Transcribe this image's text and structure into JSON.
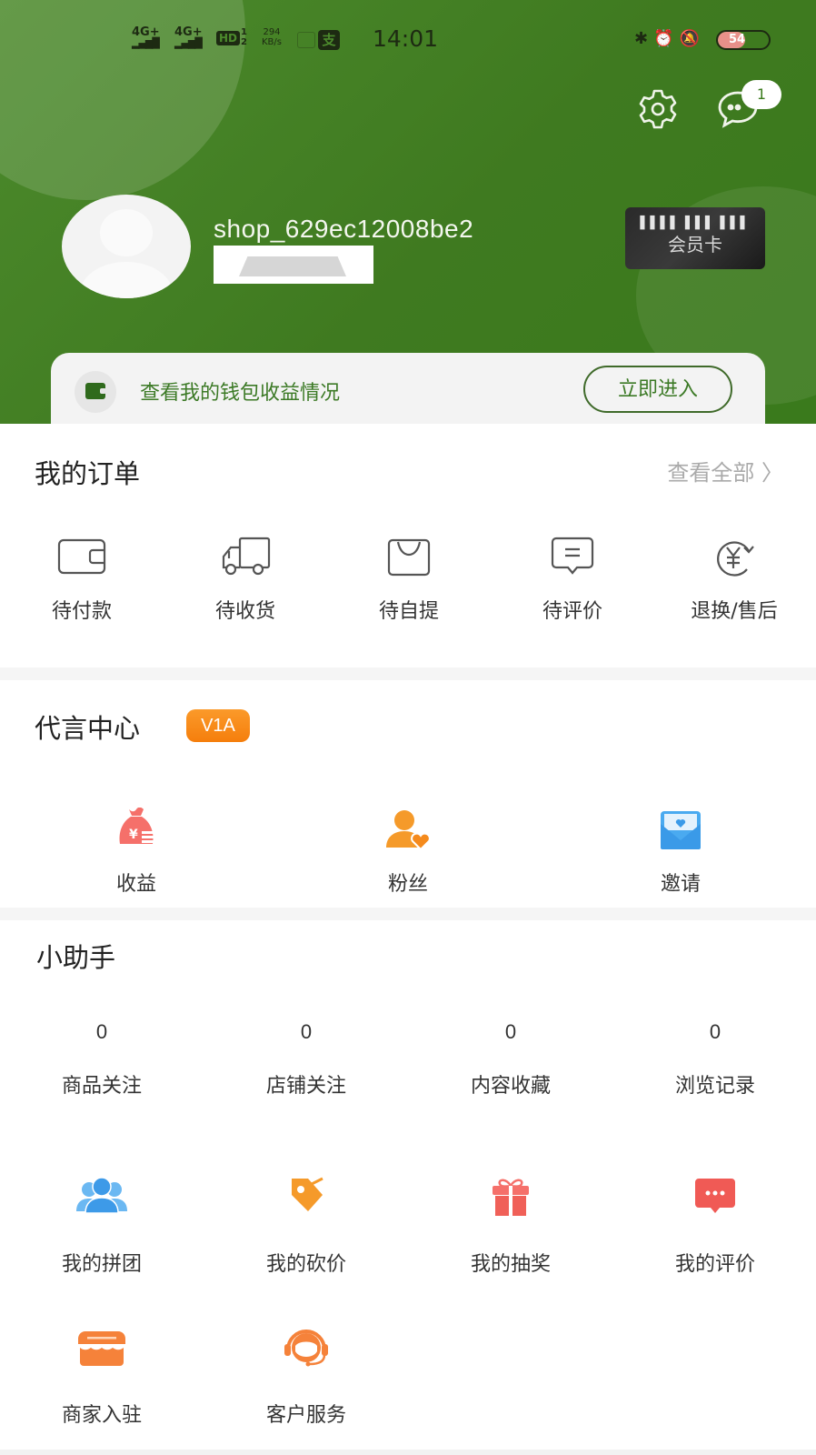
{
  "status_bar": {
    "signal1": "4G+",
    "signal2": "4G+",
    "hd": "HD",
    "hd_sim": "1 2",
    "speed_value": "294",
    "speed_unit": "KB/s",
    "pay_icon": "支",
    "time": "14:01",
    "battery": "54",
    "battery_level": 0.54
  },
  "header": {
    "message_badge": "1",
    "username": "shop_629ec12008be2",
    "member_card": {
      "barcode": "▌▌▌▌ ▌▌▌ ▌▌▌",
      "label": "会员卡"
    },
    "wallet": {
      "text": "查看我的钱包收益情况",
      "button": "立即进入"
    }
  },
  "orders": {
    "title": "我的订单",
    "view_all": "查看全部 〉",
    "items": [
      {
        "label": "待付款",
        "icon": "wallet-icon"
      },
      {
        "label": "待收货",
        "icon": "truck-icon"
      },
      {
        "label": "待自提",
        "icon": "shopping-bag-icon"
      },
      {
        "label": "待评价",
        "icon": "comment-icon"
      },
      {
        "label": "退换/售后",
        "icon": "refund-icon"
      }
    ]
  },
  "advocate": {
    "title": "代言中心",
    "badge": "V1A",
    "items": [
      {
        "label": "收益",
        "icon": "money-bag-icon"
      },
      {
        "label": "粉丝",
        "icon": "fans-icon"
      },
      {
        "label": "邀请",
        "icon": "invite-envelope-icon"
      }
    ]
  },
  "helper": {
    "title": "小助手",
    "counts": [
      {
        "value": "0",
        "label": "商品关注"
      },
      {
        "value": "0",
        "label": "店铺关注"
      },
      {
        "value": "0",
        "label": "内容收藏"
      },
      {
        "value": "0",
        "label": "浏览记录"
      }
    ],
    "tools": [
      {
        "label": "我的拼团",
        "icon": "group-icon"
      },
      {
        "label": "我的砍价",
        "icon": "price-tag-icon"
      },
      {
        "label": "我的抽奖",
        "icon": "gift-icon"
      },
      {
        "label": "我的评价",
        "icon": "review-icon"
      },
      {
        "label": "商家入驻",
        "icon": "store-icon"
      },
      {
        "label": "客户服务",
        "icon": "customer-service-icon"
      }
    ]
  },
  "colors": {
    "header_green": "#3f7a20",
    "accent_green": "#3c7a26",
    "badge_orange": "#f57e0c"
  }
}
